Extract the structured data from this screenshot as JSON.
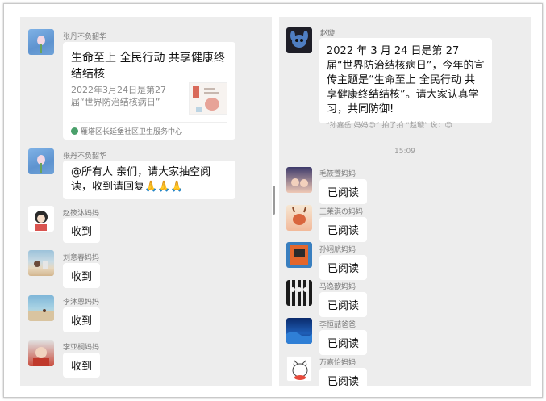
{
  "left": {
    "card_sender": "张丹不负韶华",
    "card": {
      "title": "生命至上  全民行动  共享健康终结结核",
      "description": "2022年3月24日是第27届“世界防治结核病日”",
      "source": "雁塔区长延堡社区卫生服务中心"
    },
    "notice_sender": "张丹不负韶华",
    "notice_text": "@所有人  亲们，请大家抽空阅读，收到请回复🙏🙏🙏",
    "replies": [
      {
        "name": "赵筱沐妈妈",
        "text": "收到"
      },
      {
        "name": "刘意春妈妈",
        "text": "收到"
      },
      {
        "name": "李沐恩妈妈",
        "text": "收到"
      },
      {
        "name": "李亚桐妈妈",
        "text": "收到"
      }
    ]
  },
  "right": {
    "sender": "赵璇",
    "message": "2022 年 3 月 24 日是第 27 届“世界防治结核病日”，今年的宣传主题是“生命至上  全民行动  共享健康终结结核”。请大家认真学习，共同防御!",
    "system_text": "“孙嘉岳 妈妈😊” 拍了拍 “赵璇” 说：😊",
    "time": "15:09",
    "replies": [
      {
        "name": "毛筱萱妈妈",
        "text": "已阅读"
      },
      {
        "name": "王莱淇の妈妈",
        "text": "已阅读"
      },
      {
        "name": "孙翊航妈妈",
        "text": "已阅读"
      },
      {
        "name": "马逸歆妈妈",
        "text": "已阅读"
      },
      {
        "name": "李恒喆爸爸",
        "text": "已阅读"
      },
      {
        "name": "万嘉怡妈妈",
        "text": "已阅读"
      }
    ]
  },
  "icons": {
    "source_icon": "community-health-logo-icon"
  }
}
